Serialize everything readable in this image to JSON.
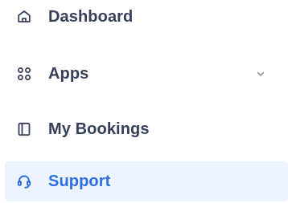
{
  "menu": {
    "items": [
      {
        "label": "Dashboard",
        "icon": "home-icon"
      },
      {
        "label": "Apps",
        "icon": "apps-icon",
        "has_submenu": true
      },
      {
        "label": "My Bookings",
        "icon": "book-icon"
      },
      {
        "label": "Support",
        "icon": "headset-icon",
        "active": true
      }
    ]
  },
  "colors": {
    "text": "#36405a",
    "icon": "#36405a",
    "active_text": "#2f6fe4",
    "active_background": "#eef4fe",
    "chevron": "#8f98aa"
  }
}
